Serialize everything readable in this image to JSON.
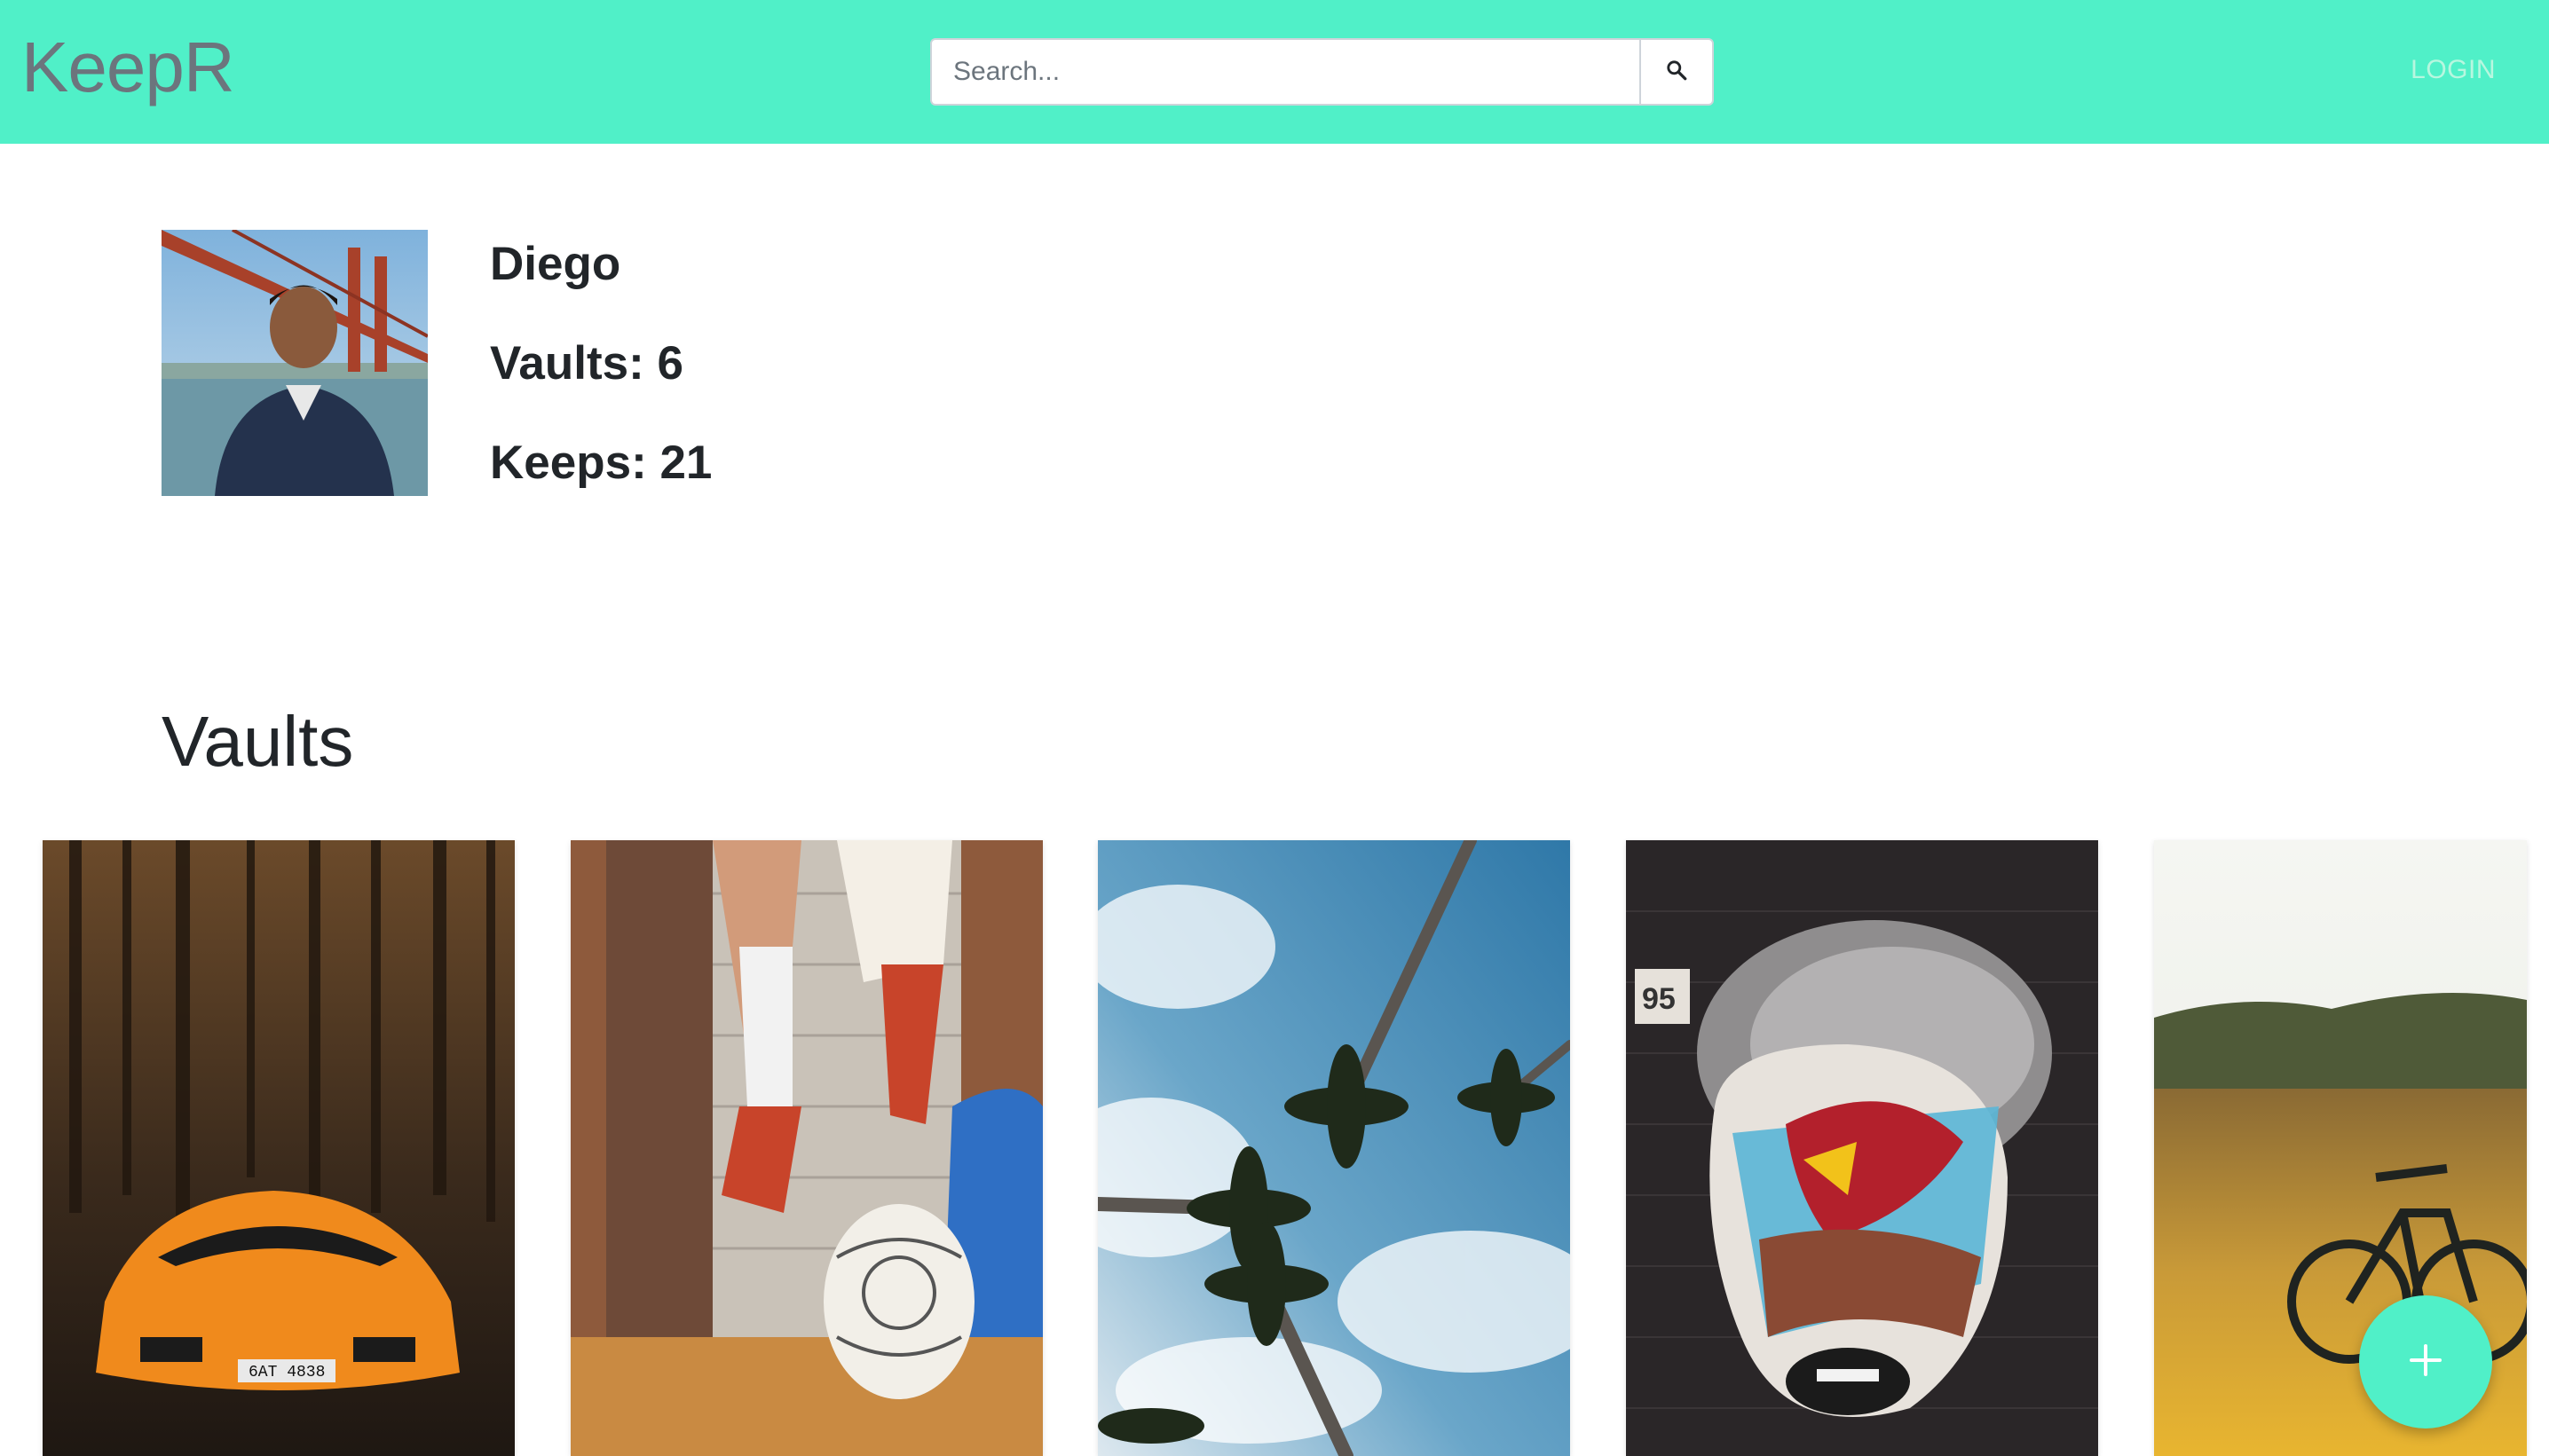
{
  "navbar": {
    "brand": "KeepR",
    "search_placeholder": "Search...",
    "login_label": "LOGIN",
    "background_color": "#50f0c8"
  },
  "profile": {
    "name": "Diego",
    "vaults_line": "Vaults: 6",
    "keeps_line": "Keeps: 21"
  },
  "vaults_section": {
    "title": "Vaults",
    "cards": [
      {
        "image": "orange-sports-car-in-forest"
      },
      {
        "image": "soccer-player-kicking-ball"
      },
      {
        "image": "palm-trees-against-sky"
      },
      {
        "image": "street-art-mural-face"
      },
      {
        "image": "mountain-bike-in-field"
      }
    ]
  },
  "fab": {
    "icon": "plus-icon"
  },
  "colors": {
    "accent": "#50f0c8",
    "text": "#212529",
    "brand_text": "#6c757d"
  }
}
